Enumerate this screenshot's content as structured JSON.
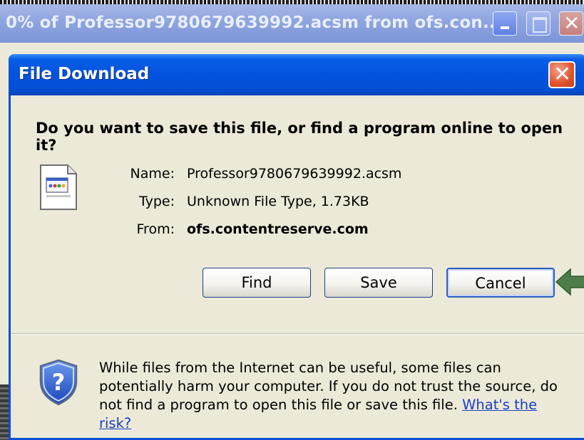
{
  "outer_window": {
    "title": "0% of Professor9780679639992.acsm from ofs.con...",
    "minimize_icon": "minimize-icon",
    "maximize_icon": "maximize-icon",
    "close_icon": "close-icon"
  },
  "dialog": {
    "title": "File Download",
    "close_icon": "close-icon",
    "question": "Do you want to save this file, or find a program online to open it?",
    "file_icon": "file-icon",
    "fields": {
      "name_label": "Name:",
      "name_value": "Professor9780679639992.acsm",
      "type_label": "Type:",
      "type_value": "Unknown File Type, 1.73KB",
      "from_label": "From:",
      "from_value": "ofs.contentreserve.com"
    },
    "buttons": {
      "find": "Find",
      "save": "Save",
      "cancel": "Cancel"
    },
    "warning": {
      "shield_icon": "shield-question-icon",
      "text": "While files from the Internet can be useful, some files can potentially harm your computer. If you do not trust the source, do not find a program to open this file or save this file.",
      "link": "What's the risk?"
    },
    "annotation_arrow_icon": "arrow-left-icon"
  },
  "colors": {
    "title_bar_blue": "#0453dd",
    "outer_title_blue": "#8fa6e0",
    "dialog_bg": "#ece9d8",
    "arrow_green": "#4e7d4a",
    "link_blue": "#1a3fc2"
  }
}
